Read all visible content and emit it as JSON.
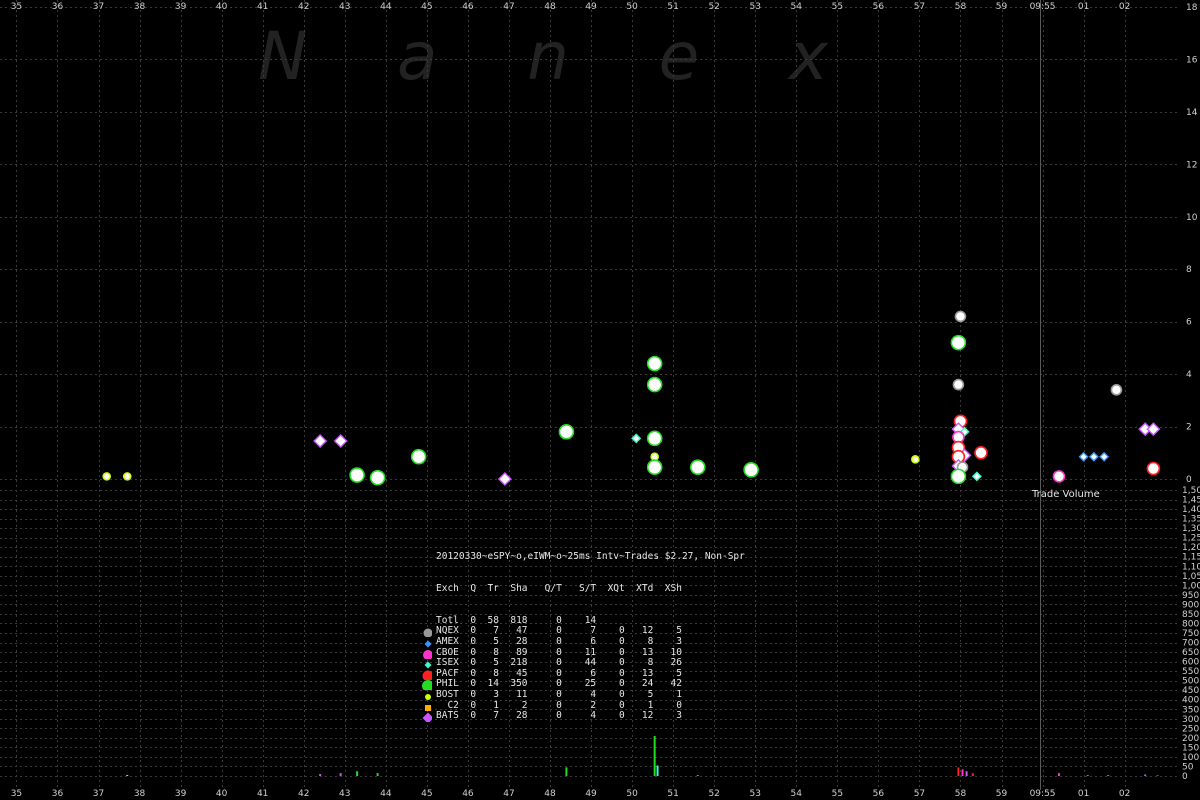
{
  "watermark": "Nanex",
  "chart_data": {
    "type": "scatter",
    "x_ticks": [
      "35",
      "36",
      "37",
      "38",
      "39",
      "40",
      "41",
      "42",
      "43",
      "44",
      "45",
      "46",
      "47",
      "48",
      "49",
      "50",
      "51",
      "52",
      "53",
      "54",
      "55",
      "56",
      "57",
      "58",
      "59",
      "09:55",
      "01",
      "02"
    ],
    "price_axis": {
      "ticks": [
        "0",
        "2",
        "4",
        "6",
        "8",
        "10",
        "12",
        "14",
        "16",
        "18"
      ],
      "ylim": [
        0,
        18
      ]
    },
    "volume_axis": {
      "label": "Trade Volume",
      "ticks": [
        "0",
        "50",
        "100",
        "150",
        "200",
        "250",
        "300",
        "350",
        "400",
        "450",
        "500",
        "550",
        "600",
        "650",
        "700",
        "750",
        "800",
        "850",
        "900",
        "950",
        "1,000",
        "1,050",
        "1,100",
        "1,150",
        "1,200",
        "1,250",
        "1,300",
        "1,350",
        "1,400",
        "1,450",
        "1,500"
      ],
      "ylim": [
        0,
        1500
      ]
    },
    "points": [
      {
        "x": 37.2,
        "y": 0.1,
        "exch": "BOST"
      },
      {
        "x": 37.7,
        "y": 0.1,
        "exch": "BOST"
      },
      {
        "x": 42.4,
        "y": 1.45,
        "exch": "BATS"
      },
      {
        "x": 42.9,
        "y": 1.45,
        "exch": "BATS"
      },
      {
        "x": 43.3,
        "y": 0.15,
        "exch": "PHIL"
      },
      {
        "x": 43.8,
        "y": 0.05,
        "exch": "PHIL"
      },
      {
        "x": 44.8,
        "y": 0.85,
        "exch": "PHIL"
      },
      {
        "x": 46.9,
        "y": 0.0,
        "exch": "BATS"
      },
      {
        "x": 48.4,
        "y": 1.8,
        "exch": "PHIL"
      },
      {
        "x": 50.1,
        "y": 1.55,
        "exch": "ISEX"
      },
      {
        "x": 50.55,
        "y": 4.4,
        "exch": "PHIL"
      },
      {
        "x": 50.55,
        "y": 3.6,
        "exch": "PHIL"
      },
      {
        "x": 50.55,
        "y": 1.55,
        "exch": "PHIL"
      },
      {
        "x": 50.55,
        "y": 0.85,
        "exch": "BOST"
      },
      {
        "x": 50.55,
        "y": 0.45,
        "exch": "PHIL"
      },
      {
        "x": 51.6,
        "y": 0.45,
        "exch": "PHIL"
      },
      {
        "x": 52.9,
        "y": 0.35,
        "exch": "PHIL"
      },
      {
        "x": 56.9,
        "y": 0.75,
        "exch": "BOST"
      },
      {
        "x": 58.0,
        "y": 6.2,
        "exch": "NQEX"
      },
      {
        "x": 57.95,
        "y": 5.2,
        "exch": "PHIL"
      },
      {
        "x": 57.95,
        "y": 3.6,
        "exch": "NQEX"
      },
      {
        "x": 58.0,
        "y": 2.2,
        "exch": "PACF"
      },
      {
        "x": 57.95,
        "y": 1.9,
        "exch": "BATS"
      },
      {
        "x": 58.1,
        "y": 1.8,
        "exch": "ISEX"
      },
      {
        "x": 57.95,
        "y": 1.6,
        "exch": "CBOE"
      },
      {
        "x": 57.95,
        "y": 1.2,
        "exch": "PACF"
      },
      {
        "x": 58.1,
        "y": 0.9,
        "exch": "BATS"
      },
      {
        "x": 57.95,
        "y": 0.85,
        "exch": "PACF"
      },
      {
        "x": 57.95,
        "y": 0.5,
        "exch": "BATS"
      },
      {
        "x": 58.05,
        "y": 0.45,
        "exch": "NQEX"
      },
      {
        "x": 57.95,
        "y": 0.1,
        "exch": "PHIL"
      },
      {
        "x": 58.4,
        "y": 0.1,
        "exch": "ISEX"
      },
      {
        "x": 58.5,
        "y": 1.0,
        "exch": "PACF"
      },
      {
        "x": 60.4,
        "y": 0.1,
        "exch": "CBOE"
      },
      {
        "x": 61.0,
        "y": 0.85,
        "exch": "AMEX"
      },
      {
        "x": 61.25,
        "y": 0.85,
        "exch": "AMEX"
      },
      {
        "x": 61.5,
        "y": 0.85,
        "exch": "AMEX"
      },
      {
        "x": 61.8,
        "y": 3.4,
        "exch": "NQEX"
      },
      {
        "x": 62.5,
        "y": 1.9,
        "exch": "BATS"
      },
      {
        "x": 62.7,
        "y": 1.9,
        "exch": "BATS"
      },
      {
        "x": 62.7,
        "y": 0.4,
        "exch": "PACF"
      }
    ],
    "volume_bars": [
      {
        "x": 37.7,
        "v": 5,
        "exch": "BOST"
      },
      {
        "x": 42.4,
        "v": 10,
        "exch": "BATS"
      },
      {
        "x": 42.9,
        "v": 15,
        "exch": "BATS"
      },
      {
        "x": 43.3,
        "v": 25,
        "exch": "PHIL"
      },
      {
        "x": 43.8,
        "v": 15,
        "exch": "PHIL"
      },
      {
        "x": 48.4,
        "v": 45,
        "exch": "PHIL"
      },
      {
        "x": 50.55,
        "v": 210,
        "exch": "PHIL"
      },
      {
        "x": 50.62,
        "v": 55,
        "exch": "ISEX"
      },
      {
        "x": 51.6,
        "v": 5,
        "exch": "PHIL"
      },
      {
        "x": 57.95,
        "v": 45,
        "exch": "PACF"
      },
      {
        "x": 58.05,
        "v": 35,
        "exch": "CBOE"
      },
      {
        "x": 58.15,
        "v": 25,
        "exch": "BATS"
      },
      {
        "x": 58.3,
        "v": 15,
        "exch": "PACF"
      },
      {
        "x": 60.4,
        "v": 15,
        "exch": "CBOE"
      },
      {
        "x": 61.1,
        "v": 5,
        "exch": "AMEX"
      },
      {
        "x": 61.6,
        "v": 5,
        "exch": "AMEX"
      },
      {
        "x": 62.5,
        "v": 8,
        "exch": "BATS"
      },
      {
        "x": 62.8,
        "v": 5,
        "exch": "PACF"
      }
    ],
    "x_range": [
      34.6,
      63.3
    ],
    "marker_line_x": 59.95
  },
  "exchange_colors": {
    "NQEX": "#999999",
    "AMEX": "#3399ff",
    "CBOE": "#ff33cc",
    "ISEX": "#33ffcc",
    "PACF": "#ff2020",
    "PHIL": "#22dd22",
    "BOST": "#ccff00",
    "C2": "#ffaa00",
    "BATS": "#cc55ff"
  },
  "legend": {
    "title": "20120330~eSPY~o,eIWM~o~25ms Intv~Trades $2.27, Non-Spr",
    "header": "Exch  Q  Tr  Sha   Q/T   S/T  XQt  XTd  XSh",
    "rows": [
      {
        "exch": "Totl",
        "text": "Totl  0  58  818     0    14",
        "marker": "none"
      },
      {
        "exch": "NQEX",
        "text": "NQEX  0   7   47     0     7    0   12    5",
        "marker": "circle",
        "size": 9
      },
      {
        "exch": "AMEX",
        "text": "AMEX  0   5   28     0     6    0    8    3",
        "marker": "diamond",
        "size": 7
      },
      {
        "exch": "CBOE",
        "text": "CBOE  0   8   89     0    11    0   13   10",
        "marker": "circle",
        "size": 10
      },
      {
        "exch": "ISEX",
        "text": "ISEX  0   5  218     0    44    0    8   26",
        "marker": "diamond",
        "size": 7
      },
      {
        "exch": "PACF",
        "text": "PACF  0   8   45     0     6    0   13    5",
        "marker": "circle",
        "size": 11
      },
      {
        "exch": "PHIL",
        "text": "PHIL  0  14  350     0    25    0   24   42",
        "marker": "circle",
        "size": 13
      },
      {
        "exch": "BOST",
        "text": "BOST  0   3   11     0     4    0    5    1",
        "marker": "circle",
        "size": 6
      },
      {
        "exch": "C2",
        "text": "  C2  0   1    2     0     2    0    1    0",
        "marker": "square",
        "size": 6
      },
      {
        "exch": "BATS",
        "text": "BATS  0   7   28     0     4    0   12    3",
        "marker": "diamond",
        "size": 11
      }
    ]
  }
}
